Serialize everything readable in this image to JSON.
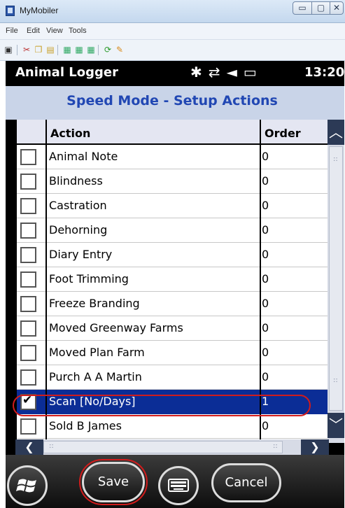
{
  "window": {
    "title": "MyMobiler",
    "controls": {
      "minimize": "▭",
      "maximize": "▢",
      "close": "✕"
    }
  },
  "menu": [
    "File",
    "Edit",
    "View",
    "Tools"
  ],
  "toolbar_icons": [
    "device-icon",
    "cut-icon",
    "copy-icon",
    "paste-icon",
    "capture-icon",
    "capture-region-icon",
    "capture-window-icon",
    "refresh-icon",
    "settings-icon"
  ],
  "device_status": {
    "app_name": "Animal Logger",
    "icons": "✱⇄◄▭",
    "time": "13:20"
  },
  "screen": {
    "title": "Speed Mode - Setup Actions"
  },
  "grid": {
    "columns": {
      "action": "Action",
      "order": "Order"
    },
    "rows": [
      {
        "checked": false,
        "action": "Animal Note",
        "order": "0"
      },
      {
        "checked": false,
        "action": "Blindness",
        "order": "0"
      },
      {
        "checked": false,
        "action": "Castration",
        "order": "0"
      },
      {
        "checked": false,
        "action": "Dehorning",
        "order": "0"
      },
      {
        "checked": false,
        "action": "Diary Entry",
        "order": "0"
      },
      {
        "checked": false,
        "action": "Foot Trimming",
        "order": "0"
      },
      {
        "checked": false,
        "action": "Freeze Branding",
        "order": "0"
      },
      {
        "checked": false,
        "action": "Moved Greenway Farms",
        "order": "0"
      },
      {
        "checked": false,
        "action": "Moved Plan Farm",
        "order": "0"
      },
      {
        "checked": false,
        "action": "Purch A A Martin",
        "order": "0"
      },
      {
        "checked": true,
        "selected": true,
        "action": "Scan [No/Days]",
        "order": "1"
      },
      {
        "checked": false,
        "action": "Sold B James",
        "order": "0"
      }
    ]
  },
  "buttons": {
    "save": "Save",
    "cancel": "Cancel"
  },
  "colors": {
    "accent_title": "#2147b3",
    "selection": "#0b2d96",
    "highlight_ring": "#d11c1c"
  }
}
